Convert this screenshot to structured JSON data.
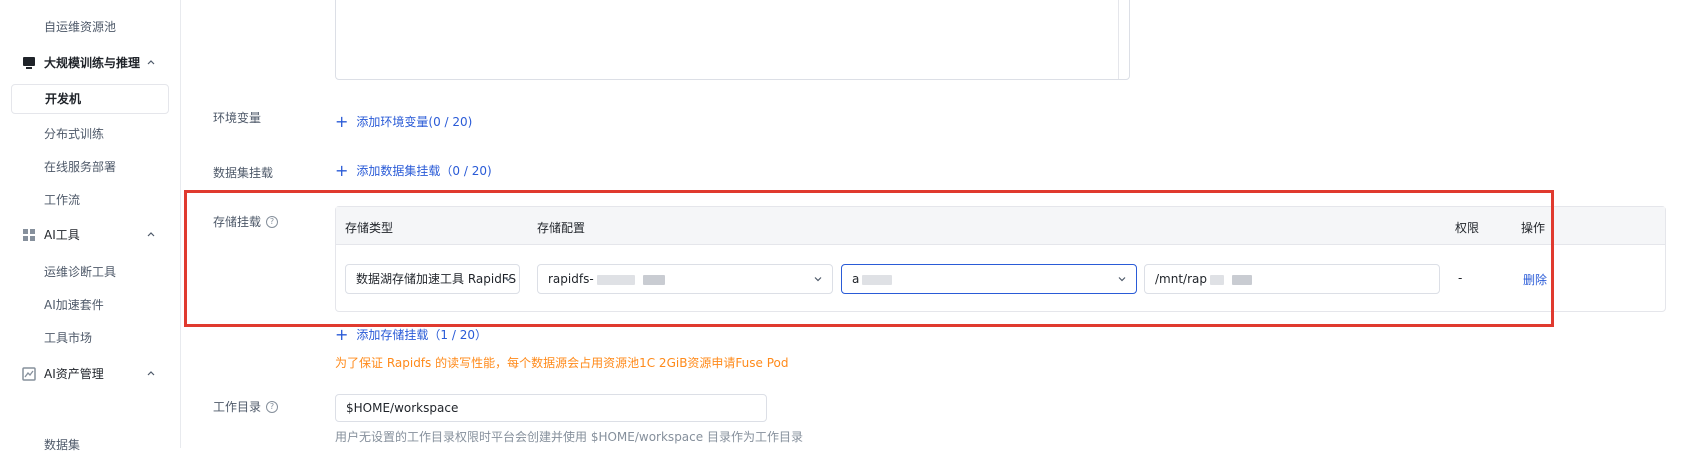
{
  "sidebar": {
    "items_top": {
      "self_ops_pool": "自运维资源池"
    },
    "group_training": {
      "label": "大规模训练与推理",
      "icon": "monitor-icon"
    },
    "training_items": [
      "开发机",
      "分布式训练",
      "在线服务部署",
      "工作流"
    ],
    "group_ai_tools": {
      "label": "AI工具",
      "icon": "grid-icon"
    },
    "ai_tool_items": [
      "运维诊断工具",
      "AI加速套件",
      "工具市场"
    ],
    "group_assets": {
      "label": "AI资产管理",
      "icon": "chart-icon"
    },
    "asset_items": [
      "数据集"
    ]
  },
  "form": {
    "env_label": "环境变量",
    "env_add": "添加环境变量(0 / 20)",
    "dataset_label": "数据集挂载",
    "dataset_add": "添加数据集挂载（0 / 20)",
    "storage_label": "存储挂载",
    "storage_add": "添加存储挂载（1 / 20）",
    "storage_table": {
      "headers": [
        "存储类型",
        "存储配置",
        "权限",
        "操作"
      ],
      "row": {
        "type": "数据湖存储加速工具 RapidFS",
        "config_prefix": "rapidfs-",
        "account_prefix": "a",
        "path_prefix": "/mnt/rap",
        "permission": "-",
        "action": "删除"
      }
    },
    "warning": "为了保证 Rapidfs 的读写性能，每个数据源会占用资源池1C 2GiB资源申请Fuse Pod",
    "workdir_label": "工作目录",
    "workdir_value": "$HOME/workspace",
    "workdir_hint": "用户无设置的工作目录权限时平台会创建并使用 $HOME/workspace 目录作为工作目录"
  },
  "colors": {
    "accent": "#2a5bd7",
    "highlight": "#e03a2f",
    "warning": "#ff8a1a"
  }
}
